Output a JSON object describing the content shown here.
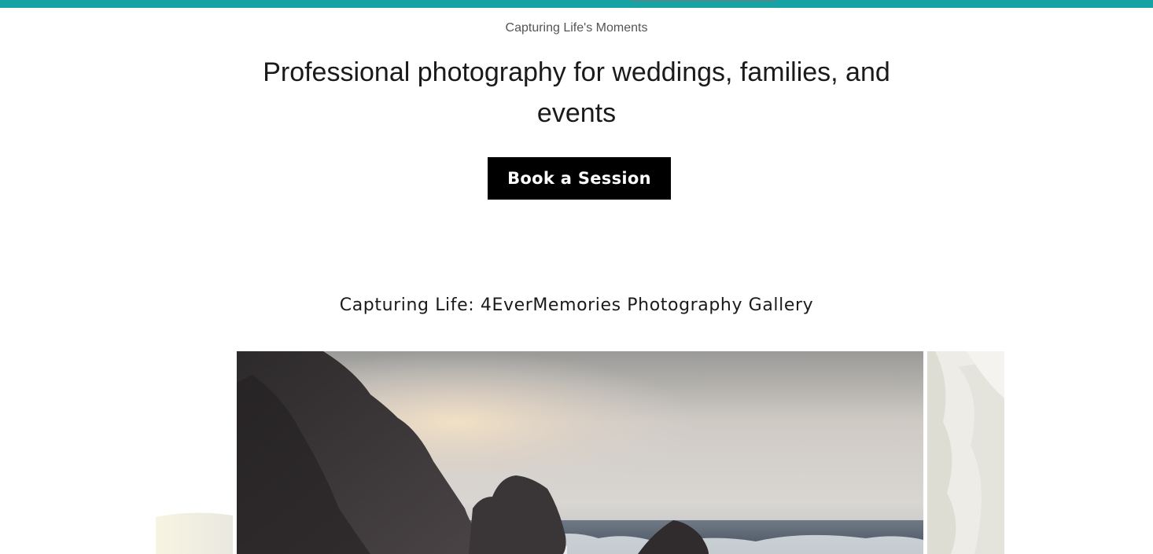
{
  "header": {
    "accent_color": "#17a3a3",
    "tagline": "Capturing Life's Moments"
  },
  "hero": {
    "headline": "Professional photography for weddings, families, and events",
    "cta_label": "Book a Session"
  },
  "gallery": {
    "title": "Capturing Life: 4EverMemories Photography Gallery",
    "slides": [
      {
        "name": "previous-slide-image",
        "subject": "sunlit sky"
      },
      {
        "name": "current-slide-image",
        "subject": "rocky coastline with crashing waves"
      },
      {
        "name": "next-slide-image",
        "subject": "trees"
      }
    ]
  }
}
